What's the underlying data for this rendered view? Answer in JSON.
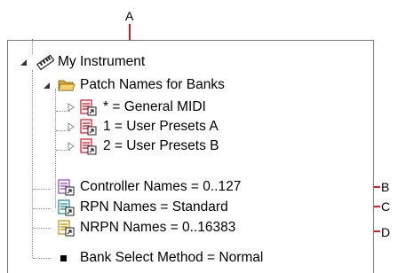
{
  "callouts": {
    "a": "A",
    "b": "B",
    "c": "C",
    "d": "D"
  },
  "tree": {
    "root": {
      "label": "My Instrument",
      "icon": "instrument-keyboard-icon",
      "expanded": true
    },
    "patch_folder": {
      "label": "Patch Names for Banks",
      "icon": "open-folder-icon",
      "expanded": true
    },
    "patch_items": [
      {
        "label": "* = General MIDI",
        "icon": "patch-names-icon"
      },
      {
        "label": "1 = User Presets A",
        "icon": "patch-names-icon"
      },
      {
        "label": "2 = User Presets B",
        "icon": "patch-names-icon"
      }
    ],
    "controller": {
      "label": "Controller Names = 0..127",
      "icon": "controller-names-icon"
    },
    "rpn": {
      "label": "RPN Names = Standard",
      "icon": "rpn-names-icon"
    },
    "nrpn": {
      "label": "NRPN Names = 0..16383",
      "icon": "nrpn-names-icon"
    },
    "bank_select": {
      "label": "Bank Select Method = Normal",
      "icon": "bullet-icon"
    }
  },
  "colors": {
    "callout_line": "#d0202a",
    "patch_icon": "#e0303a",
    "controller_icon": "#a060c8",
    "rpn_icon": "#3a9a9a",
    "nrpn_icon": "#c8a020",
    "folder": "#f0c850"
  }
}
